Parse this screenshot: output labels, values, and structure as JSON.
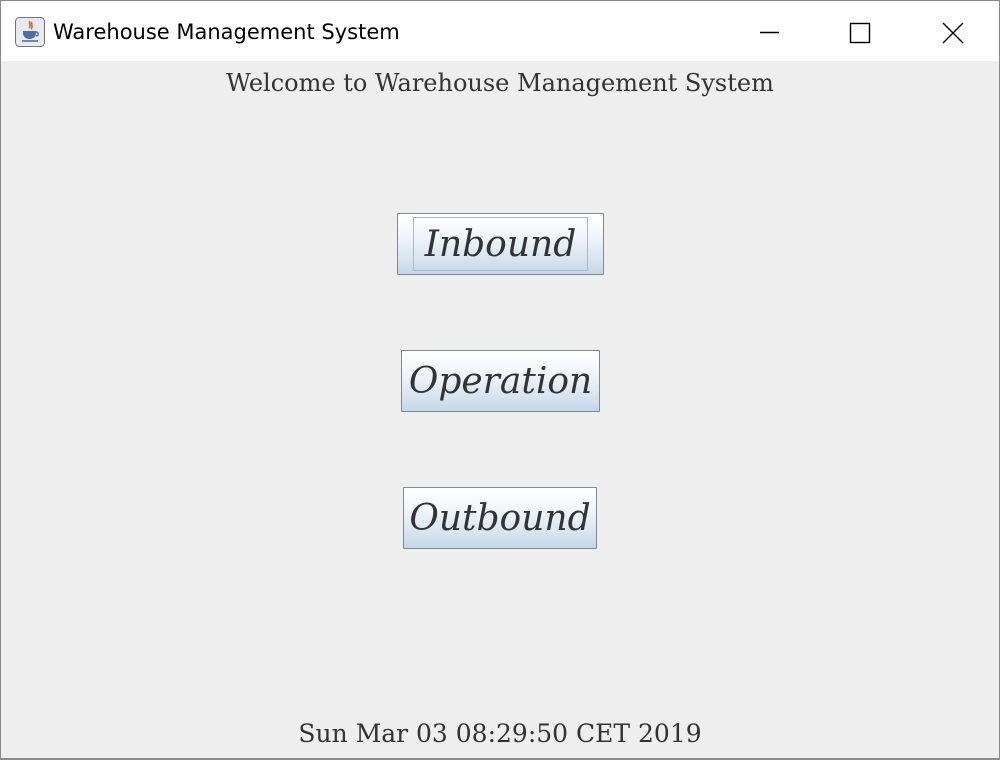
{
  "window": {
    "title": "Warehouse Management System",
    "app_icon": "java-coffee-cup-icon",
    "controls": [
      "minimize-icon",
      "maximize-icon",
      "close-icon"
    ]
  },
  "main": {
    "welcome_text": "Welcome to Warehouse Management System",
    "buttons": {
      "inbound": "Inbound",
      "operation": "Operation",
      "outbound": "Outbound"
    },
    "datetime": "Sun Mar 03 08:29:50 CET 2019"
  },
  "colors": {
    "background": "#eeeeee",
    "button_gradient_top": "#ffffff",
    "button_gradient_bottom": "#c4d6e8",
    "text": "#333333"
  }
}
